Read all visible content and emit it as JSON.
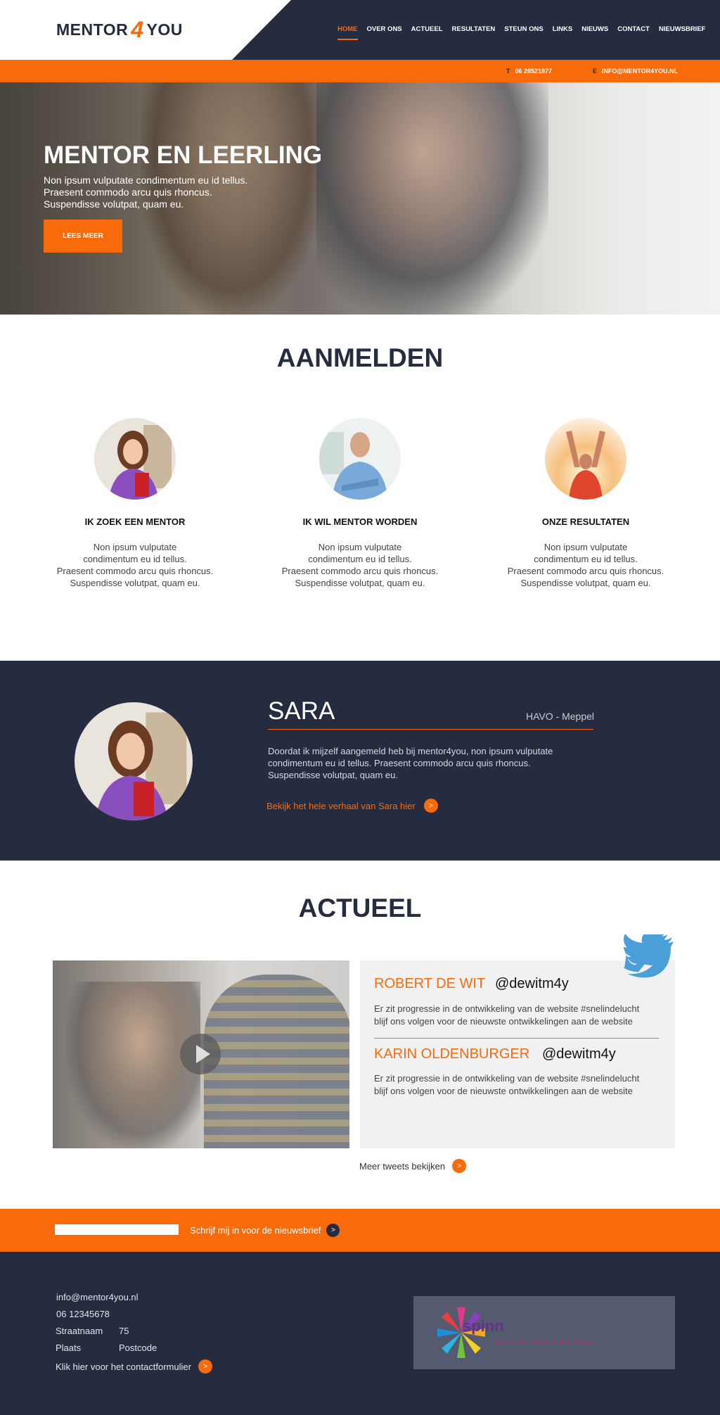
{
  "header": {
    "logo": {
      "part1": "MENTOR",
      "part2": "4",
      "part3": "YOU"
    },
    "nav": [
      {
        "label": "HOME",
        "active": true
      },
      {
        "label": "OVER ONS",
        "active": false
      },
      {
        "label": "ACTUEEL",
        "active": false
      },
      {
        "label": "RESULTATEN",
        "active": false
      },
      {
        "label": "STEUN ONS",
        "active": false
      },
      {
        "label": "LINKS",
        "active": false
      },
      {
        "label": "NIEUWS",
        "active": false
      },
      {
        "label": "CONTACT",
        "active": false
      },
      {
        "label": "NIEUWSBRIEF",
        "active": false
      }
    ]
  },
  "contact_bar": {
    "phone_label": "T",
    "phone": "06 28521877",
    "email_label": "E",
    "email": "INFO@MENTOR4YOU.NL"
  },
  "hero": {
    "title": "MENTOR EN LEERLING",
    "lines": [
      "Non ipsum vulputate condimentum eu id tellus.",
      "Praesent commodo arcu quis rhoncus.",
      "Suspendisse volutpat, quam eu."
    ],
    "button": "LEES MEER"
  },
  "aanmelden": {
    "title": "AANMELDEN",
    "cards": [
      {
        "title": "IK ZOEK EEN MENTOR",
        "lines": [
          "Non ipsum vulputate",
          "condimentum eu id tellus.",
          "Praesent commodo arcu quis rhoncus.",
          "Suspendisse volutpat, quam eu."
        ]
      },
      {
        "title": "IK WIL MENTOR WORDEN",
        "lines": [
          "Non ipsum vulputate",
          "condimentum eu id tellus.",
          "Praesent commodo arcu quis rhoncus.",
          "Suspendisse volutpat, quam eu."
        ]
      },
      {
        "title": "ONZE RESULTATEN",
        "lines": [
          "Non ipsum vulputate",
          "condimentum eu id tellus.",
          "Praesent commodo arcu quis rhoncus.",
          "Suspendisse volutpat, quam eu."
        ]
      }
    ]
  },
  "testimonial": {
    "name": "SARA",
    "school": "HAVO - Meppel",
    "lines": [
      "Doordat ik mijzelf aangemeld heb bij mentor4you,  non ipsum vulputate",
      "condimentum eu id tellus. Praesent commodo arcu quis rhoncus.",
      "Suspendisse volutpat, quam eu."
    ],
    "link": "Bekijk het hele verhaal van Sara hier",
    "link_icon": ">"
  },
  "actueel": {
    "title": "ACTUEEL",
    "tweets": [
      {
        "name": "ROBERT DE WIT",
        "handle": "@dewitm4y",
        "lines": [
          "Er zit progressie in de ontwikkeling van de website  #snelindelucht",
          "blijf ons volgen voor de nieuwste ontwikkelingen aan de website"
        ]
      },
      {
        "name": "KARIN OLDENBURGER",
        "handle": "@dewitm4y",
        "lines": [
          "Er zit progressie in de ontwikkeling van de website #snelindelucht",
          "blijf ons volgen voor de nieuwste ontwikkelingen aan de website"
        ]
      }
    ],
    "more": "Meer tweets bekijken",
    "more_icon": ">"
  },
  "newsletter": {
    "placeholder": "",
    "label": "Schrijf mij in voor de nieuwsbrief",
    "icon": ">"
  },
  "footer": {
    "email": "info@mentor4you.nl",
    "phone": "06 12345678",
    "street": "Straatnaam",
    "number": "75",
    "city": "Plaats",
    "postcode": "Postcode",
    "contact_link": "Klik hier voor het contactformulier",
    "contact_icon": ">",
    "partner": {
      "name": "spinn",
      "tagline": "netwerk voor sociale ondernemingen"
    }
  },
  "colors": {
    "navy": "#252c40",
    "orange": "#f86a0a",
    "twitter_blue": "#4a9fd8"
  }
}
